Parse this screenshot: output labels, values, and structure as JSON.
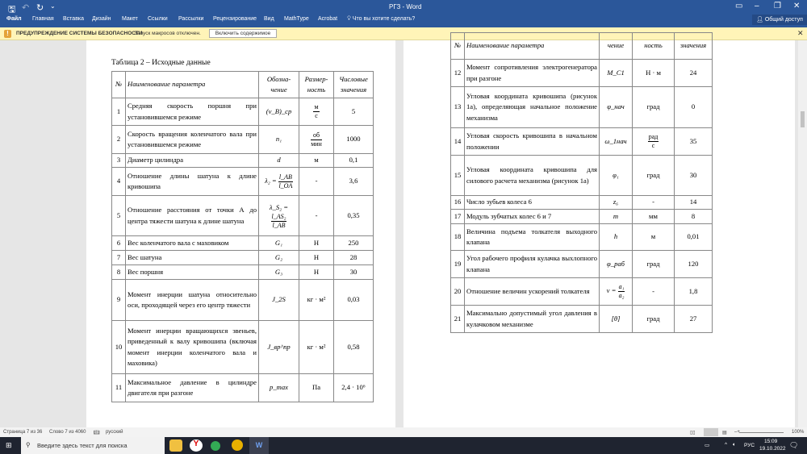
{
  "titlebar": {
    "title": "РГЗ - Word",
    "share": "Общий доступ"
  },
  "ribbon": {
    "tabs": [
      "Файл",
      "Главная",
      "Вставка",
      "Дизайн",
      "Макет",
      "Ссылки",
      "Рассылки",
      "Рецензирование",
      "Вид",
      "MathType",
      "Acrobat"
    ],
    "tell_me": "Что вы хотите сделать?"
  },
  "warning": {
    "title": "ПРЕДУПРЕЖДЕНИЕ СИСТЕМЫ БЕЗОПАСНОСТИ",
    "message": "Запуск макросов отключен.",
    "button": "Включить содержимое"
  },
  "left_table": {
    "caption": "Таблица 2 – Исходные данные",
    "headers": [
      "№",
      "Наименование параметра",
      "Обозна-чение",
      "Размер-ность",
      "Числовые значения"
    ],
    "rows": [
      {
        "n": "1",
        "name": "Средняя скорость поршня при установившемся режиме",
        "sym": "(v_B)_ср",
        "unit": {
          "num": "м",
          "den": "с"
        },
        "val": "5"
      },
      {
        "n": "2",
        "name": "Скорость вращения коленчатого вала при установившемся режиме",
        "sym": "n₁",
        "unit": {
          "num": "об",
          "den": "мин"
        },
        "val": "1000"
      },
      {
        "n": "3",
        "name": "Диаметр цилиндра",
        "sym": "d",
        "unit": "м",
        "val": "0,1"
      },
      {
        "n": "4",
        "name": "Отношение длины шатуна к длине кривошипа",
        "sym": {
          "pre": "λ₂ =",
          "num": "l_AB",
          "den": "l_OA"
        },
        "unit": "-",
        "val": "3,6"
      },
      {
        "n": "5",
        "name": "Отношение расстояния от точки А до центра тяжести шатуна к длине шатуна",
        "sym": {
          "pre": "λ_S₂ =",
          "num": "l_AS₂",
          "den": "l_AB"
        },
        "unit": "-",
        "val": "0,35"
      },
      {
        "n": "6",
        "name": "Вес коленчатого вала с маховиком",
        "sym": "G₁",
        "unit": "Н",
        "val": "250"
      },
      {
        "n": "7",
        "name": "Вес шатуна",
        "sym": "G₂",
        "unit": "Н",
        "val": "28"
      },
      {
        "n": "8",
        "name": "Вес поршня",
        "sym": "G₃",
        "unit": "Н",
        "val": "30"
      },
      {
        "n": "9",
        "name": "Момент инерции шатуна относительно оси, проходящей через его центр тяжести",
        "sym": "J_2S",
        "unit": "кг · м²",
        "val": "0,03"
      },
      {
        "n": "10",
        "name": "Момент инерции вращающихся звеньев, приведенный к валу кривошипа (включая момент инерции коленчатого вала и маховика)",
        "sym": "J_вр^пр",
        "unit": "кг · м²",
        "val": "0,58"
      },
      {
        "n": "11",
        "name": "Максимальное давление в цилиндре двигателя при разгоне",
        "sym": "p_max",
        "unit": "Па",
        "val": "2,4 · 10⁶"
      }
    ]
  },
  "right_table": {
    "headers": [
      "№",
      "Наименование параметра",
      "чение",
      "ность",
      "значения"
    ],
    "rows": [
      {
        "n": "12",
        "name": "Момент сопротивления электрогенератора при разгоне",
        "sym": "M_C1",
        "unit": "Н · м",
        "val": "24"
      },
      {
        "n": "13",
        "name": "Угловая координата кривошипа (рисунок 1а), определяющая начальное положение механизма",
        "sym": "φ_нач",
        "unit": "град",
        "val": "0"
      },
      {
        "n": "14",
        "name": "Угловая скорость кривошипа в начальном положении",
        "sym": "ω_1нач",
        "unit": {
          "num": "рад",
          "den": "с"
        },
        "val": "35"
      },
      {
        "n": "15",
        "name": "Угловая координата кривошипа для силового расчета механизма (рисунок 1а)",
        "sym": "φ₁",
        "unit": "град",
        "val": "30"
      },
      {
        "n": "16",
        "name": "Число зубьев колеса 6",
        "sym": "z₆",
        "unit": "-",
        "val": "14"
      },
      {
        "n": "17",
        "name": "Модуль зубчатых колес 6 и 7",
        "sym": "m",
        "unit": "мм",
        "val": "8"
      },
      {
        "n": "18",
        "name": "Величина подъема толкателя выходного клапана",
        "sym": "h",
        "unit": "м",
        "val": "0,01"
      },
      {
        "n": "19",
        "name": "Угол рабочего профиля кулачка выхлопного клапана",
        "sym": "φ_раб",
        "unit": "град",
        "val": "120"
      },
      {
        "n": "20",
        "name": "Отношение величин ускорений толкателя",
        "sym": {
          "pre": "ν =",
          "num": "a₁",
          "den": "a₂"
        },
        "unit": "-",
        "val": "1,8"
      },
      {
        "n": "21",
        "name": "Максимально допустимый угол давления в кулачковом механизме",
        "sym": "[θ]",
        "unit": "град",
        "val": "27"
      }
    ]
  },
  "status": {
    "page": "Страница 7 из 36",
    "words": "Слово 7 из 4060",
    "lang": "русский",
    "zoom": "100%"
  },
  "taskbar": {
    "search": "Введите здесь текст для поиска",
    "lang": "РУС",
    "time": "15:09",
    "date": "19.10.2022"
  }
}
